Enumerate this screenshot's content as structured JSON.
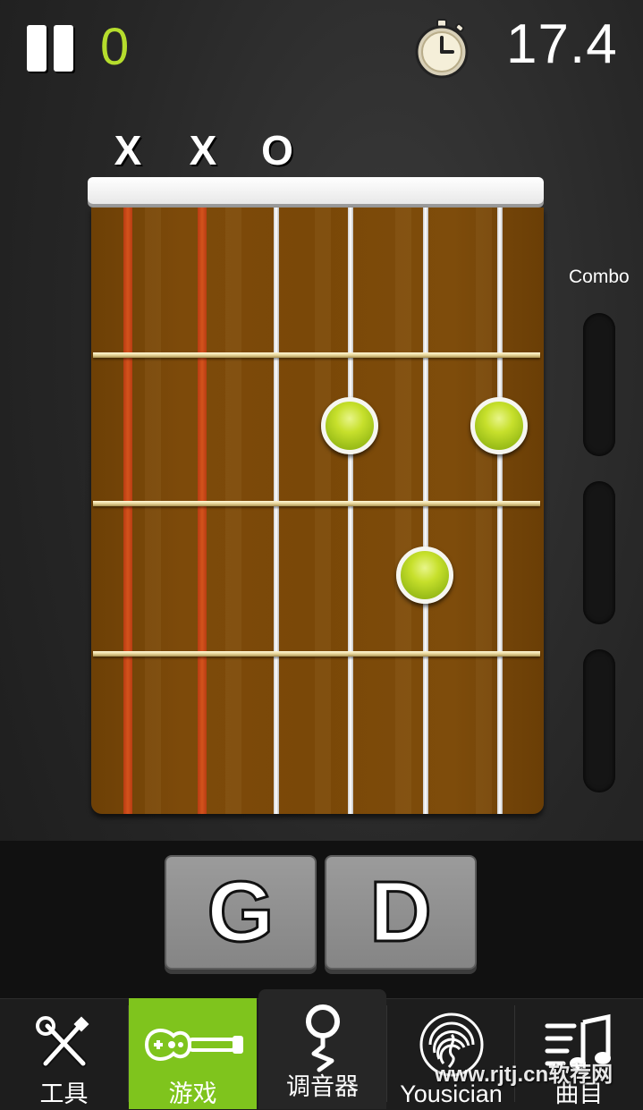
{
  "top_bar": {
    "score": "0",
    "timer": "17.4"
  },
  "chord_diagram": {
    "string_markers": [
      "X",
      "X",
      "O"
    ],
    "combo_label": "Combo",
    "finger_positions": [
      {
        "string": 4,
        "fret": 2
      },
      {
        "string": 6,
        "fret": 2
      },
      {
        "string": 5,
        "fret": 3
      }
    ]
  },
  "chord_choices": [
    "G",
    "D"
  ],
  "nav": {
    "items": [
      {
        "label": "工具",
        "icon": "tools-icon"
      },
      {
        "label": "游戏",
        "icon": "guitar-icon"
      },
      {
        "label": "调音器",
        "icon": "tuner-pin-icon"
      },
      {
        "label": "Yousician",
        "icon": "fingerprint-icon"
      },
      {
        "label": "曲目",
        "icon": "music-list-icon"
      }
    ]
  },
  "watermark": "www.rjtj.cn软荐网",
  "colors": {
    "accent_green": "#7fc41d",
    "score_green": "#b6dd2d",
    "fretboard_brown": "#7a4808"
  }
}
